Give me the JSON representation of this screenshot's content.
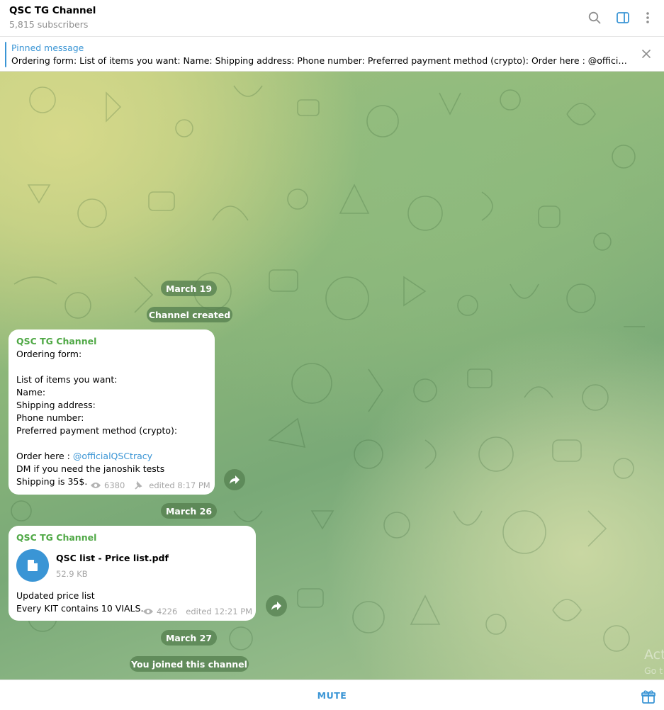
{
  "header": {
    "title": "QSC TG Channel",
    "subtitle": "5,815 subscribers",
    "icons": [
      "search-icon",
      "sidebar-toggle-icon",
      "more-vertical-icon"
    ]
  },
  "pinned": {
    "label": "Pinned message",
    "text": "Ordering form:  List of items you want: Name: Shipping address: Phone number: Preferred payment method (crypto):  Order here : @officialQSC..."
  },
  "chat": {
    "date_1": "March 19",
    "service_1": "Channel created",
    "message_1": {
      "sender": "QSC TG Channel",
      "lines": [
        "Ordering form:",
        "",
        "List of items you want:",
        "Name:",
        "Shipping address:",
        "Phone number:",
        "Preferred payment method (crypto):",
        ""
      ],
      "order_prefix": "Order here : ",
      "order_link": "@officialQSCtracy",
      "line_dm": "DM if you need the janoshik tests",
      "line_shipping": "Shipping is 35$.",
      "views": "6380",
      "edited": "edited 8:17 PM"
    },
    "date_2": "March 26",
    "message_2": {
      "sender": "QSC TG Channel",
      "file_name": "QSC  list - Price list.pdf",
      "file_size": "52.9 KB",
      "line_1": "Updated price list",
      "line_2": "Every KIT contains 10 VIALS.",
      "views": "4226",
      "edited": "edited 12:21 PM"
    },
    "date_3": "March 27",
    "service_2": "You joined this channel"
  },
  "watermark": {
    "line_1": "Act",
    "line_2": "Go t"
  },
  "footer": {
    "mute_label": "MUTE"
  },
  "colors": {
    "accent": "#3a95d5",
    "sender": "#4fa845",
    "meta": "#a6a6a6",
    "pill": "#568050"
  }
}
